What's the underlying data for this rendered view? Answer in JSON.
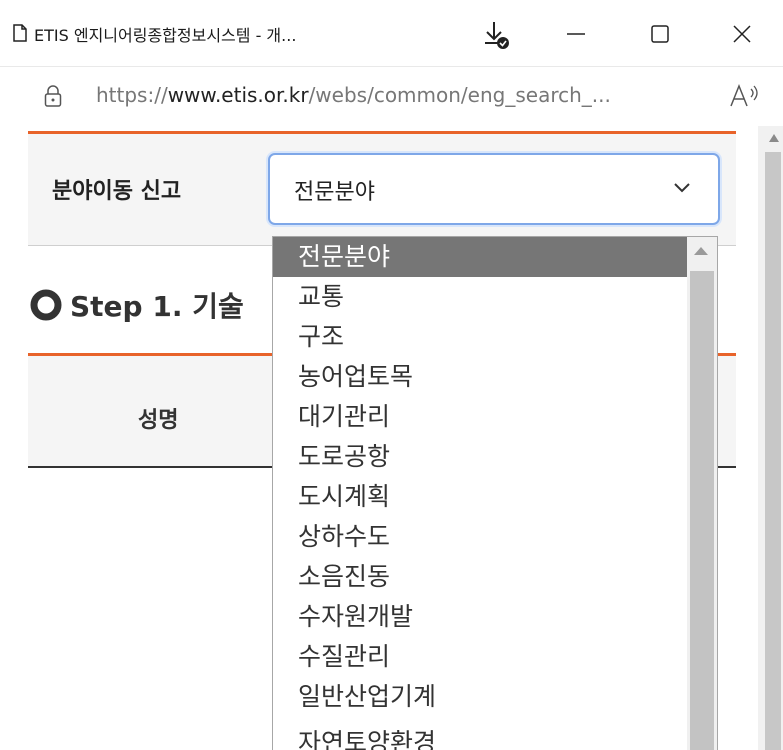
{
  "browser": {
    "tab_title": "ETIS 엔지니어링종합정보시스템 - 개...",
    "url_prefix": "https://",
    "url_domain": "www.etis.or.kr",
    "url_path": "/webs/common/eng_search_...",
    "icons": {
      "page": "page-icon",
      "download": "download-icon",
      "minimize": "minimize-icon",
      "maximize": "maximize-icon",
      "close": "close-icon",
      "lock": "lock-icon",
      "read_aloud": "read-aloud-icon"
    }
  },
  "form": {
    "field_label": "분야이동 신고",
    "select": {
      "value": "전문분야",
      "options": [
        "전문분야",
        "교통",
        "구조",
        "농어업토목",
        "대기관리",
        "도로공항",
        "도시계획",
        "상하수도",
        "소음진동",
        "수자원개발",
        "수질관리",
        "일반산업기계",
        "자연토양환경"
      ]
    }
  },
  "step": {
    "title": "Step 1. 기술"
  },
  "table": {
    "columns": [
      "성명"
    ]
  },
  "colors": {
    "accent": "#e8632a",
    "select_border": "#7ea7e8",
    "selected_option_bg": "#767676"
  }
}
